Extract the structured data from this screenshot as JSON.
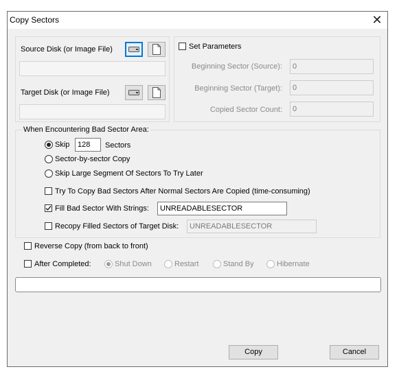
{
  "window": {
    "title": "Copy Sectors",
    "close_glyph": "✕"
  },
  "source": {
    "label": "Source Disk (or Image File)",
    "value": ""
  },
  "target": {
    "label": "Target Disk (or Image File)",
    "value": ""
  },
  "params": {
    "checkbox_label": "Set Parameters",
    "checked": false,
    "beginning_source_label": "Beginning Sector (Source):",
    "beginning_source_value": "0",
    "beginning_target_label": "Beginning Sector (Target):",
    "beginning_target_value": "0",
    "count_label": "Copied Sector Count:",
    "count_value": "0"
  },
  "bad_sector": {
    "group_label": "When Encountering Bad Sector Area:",
    "skip_label": "Skip",
    "skip_value": "128",
    "skip_units": "Sectors",
    "by_sector_label": "Sector-by-sector Copy",
    "skip_large_label": "Skip Large Segment Of Sectors To Try Later",
    "try_copy_label": "Try To Copy Bad Sectors After Normal Sectors Are Copied (time-consuming)",
    "fill_label": "Fill Bad Sector With Strings:",
    "fill_value": "UNREADABLESECTOR",
    "recopy_label": "Recopy Filled Sectors of Target Disk:",
    "recopy_value": "UNREADABLESECTOR"
  },
  "reverse_label": "Reverse Copy (from back to front)",
  "after": {
    "label": "After Completed:",
    "options": [
      "Shut Down",
      "Restart",
      "Stand By",
      "Hibernate"
    ]
  },
  "buttons": {
    "copy": "Copy",
    "cancel": "Cancel"
  },
  "colors": {
    "accent": "#0078d7",
    "window_bg": "#f0f0f0"
  }
}
